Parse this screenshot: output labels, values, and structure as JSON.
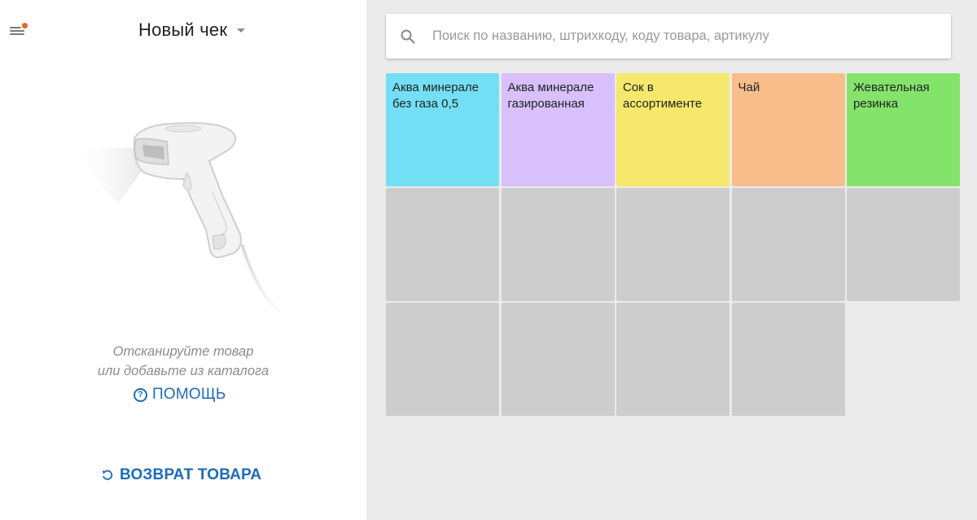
{
  "header": {
    "title": "Новый чек"
  },
  "left": {
    "hint_line1": "Отсканируйте товар",
    "hint_line2": "или добавьте из каталога",
    "help_label": "ПОМОЩЬ",
    "help_icon_glyph": "?",
    "return_label": "ВОЗВРАТ ТОВАРА"
  },
  "search": {
    "placeholder": "Поиск по названию, штрихкоду, коду товара, артикулу",
    "value": ""
  },
  "tiles": [
    {
      "label": "Аква минерале без газа 0,5",
      "color": "#73dff4"
    },
    {
      "label": "Аква минерале газированная",
      "color": "#d7c0fb"
    },
    {
      "label": "Сок в ассортименте",
      "color": "#f5e86c"
    },
    {
      "label": "Чай",
      "color": "#f7be8c"
    },
    {
      "label": "Жевательная резинка",
      "color": "#84e36b"
    }
  ],
  "empty_tiles_count": 9,
  "icons": {
    "menu": "menu-icon",
    "notification": "notification-dot",
    "dropdown": "chevron-down-icon",
    "scanner": "barcode-scanner-illustration",
    "help": "help-circle-icon",
    "return": "undo-icon",
    "search": "search-icon"
  },
  "colors": {
    "accent_link": "#1e6bbb",
    "notification_dot": "#e8622c",
    "empty_tile": "#cdcdcd",
    "right_background": "#ebebeb"
  }
}
